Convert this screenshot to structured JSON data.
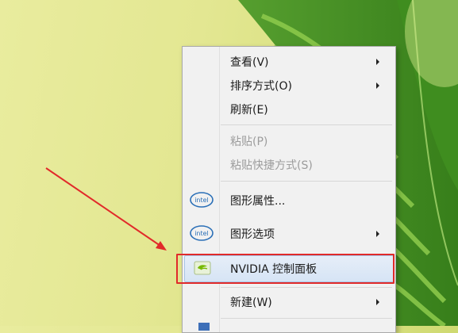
{
  "menu": {
    "items": [
      {
        "label": "查看(V)",
        "submenu": true
      },
      {
        "label": "排序方式(O)",
        "submenu": true
      },
      {
        "label": "刷新(E)",
        "submenu": false
      },
      {
        "label": "粘贴(P)",
        "submenu": false,
        "disabled": true
      },
      {
        "label": "粘贴快捷方式(S)",
        "submenu": false,
        "disabled": true
      },
      {
        "label": "图形属性...",
        "submenu": false,
        "icon": "intel-icon"
      },
      {
        "label": "图形选项",
        "submenu": true,
        "icon": "intel-icon"
      },
      {
        "label": "NVIDIA 控制面板",
        "submenu": false,
        "icon": "nvidia-icon",
        "highlighted": true
      },
      {
        "label": "新建(W)",
        "submenu": true
      }
    ],
    "intel_text": "intel"
  },
  "colors": {
    "highlight_border": "#e12a2a",
    "arrow": "#e12a2a",
    "nvidia_green": "#76b900"
  }
}
